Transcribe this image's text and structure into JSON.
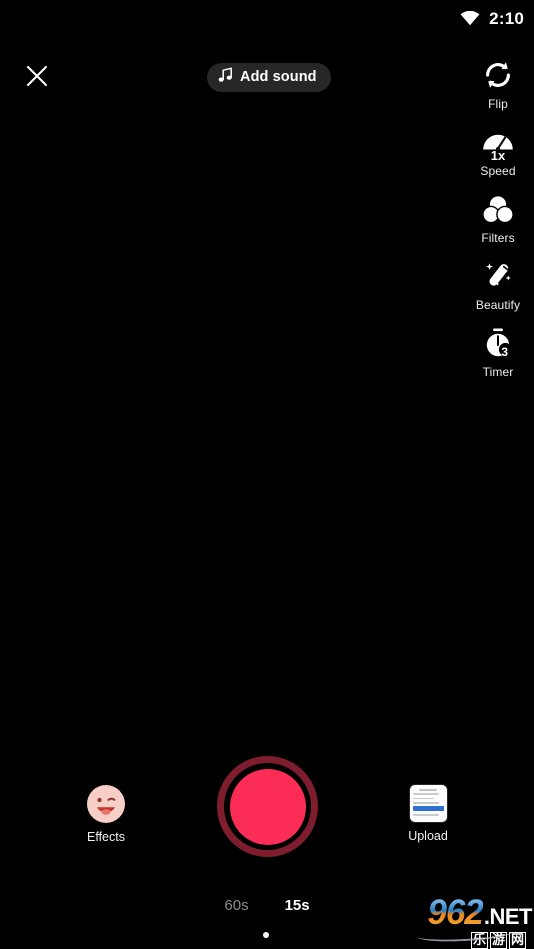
{
  "status_bar": {
    "time": "2:10",
    "wifi_icon": "wifi-full-icon"
  },
  "top_bar": {
    "close_icon": "close-x-icon",
    "add_sound": {
      "label": "Add sound",
      "icon": "music-note-icon"
    }
  },
  "right_rail": {
    "items": [
      {
        "icon": "flip-camera-icon",
        "label": "Flip"
      },
      {
        "icon": "speedometer-icon",
        "label": "Speed",
        "badge": "1x"
      },
      {
        "icon": "filters-circles-icon",
        "label": "Filters"
      },
      {
        "icon": "magic-wand-icon",
        "label": "Beautify"
      },
      {
        "icon": "stopwatch-icon",
        "label": "Timer",
        "badge": "3"
      }
    ]
  },
  "bottom_controls": {
    "effects": {
      "label": "Effects",
      "icon": "winking-face-icon"
    },
    "record": {
      "icon": "record-button",
      "ring_color": "#7d1d2e",
      "fill_color": "#fb2c55"
    },
    "upload": {
      "label": "Upload",
      "icon": "gallery-thumbnail-icon"
    }
  },
  "duration_selector": {
    "options": [
      {
        "label": "60s",
        "selected": false
      },
      {
        "label": "15s",
        "selected": true
      }
    ]
  },
  "watermark": {
    "number": "962",
    "tld": ".NET",
    "cn_chars": [
      "乐",
      "游",
      "网"
    ]
  }
}
